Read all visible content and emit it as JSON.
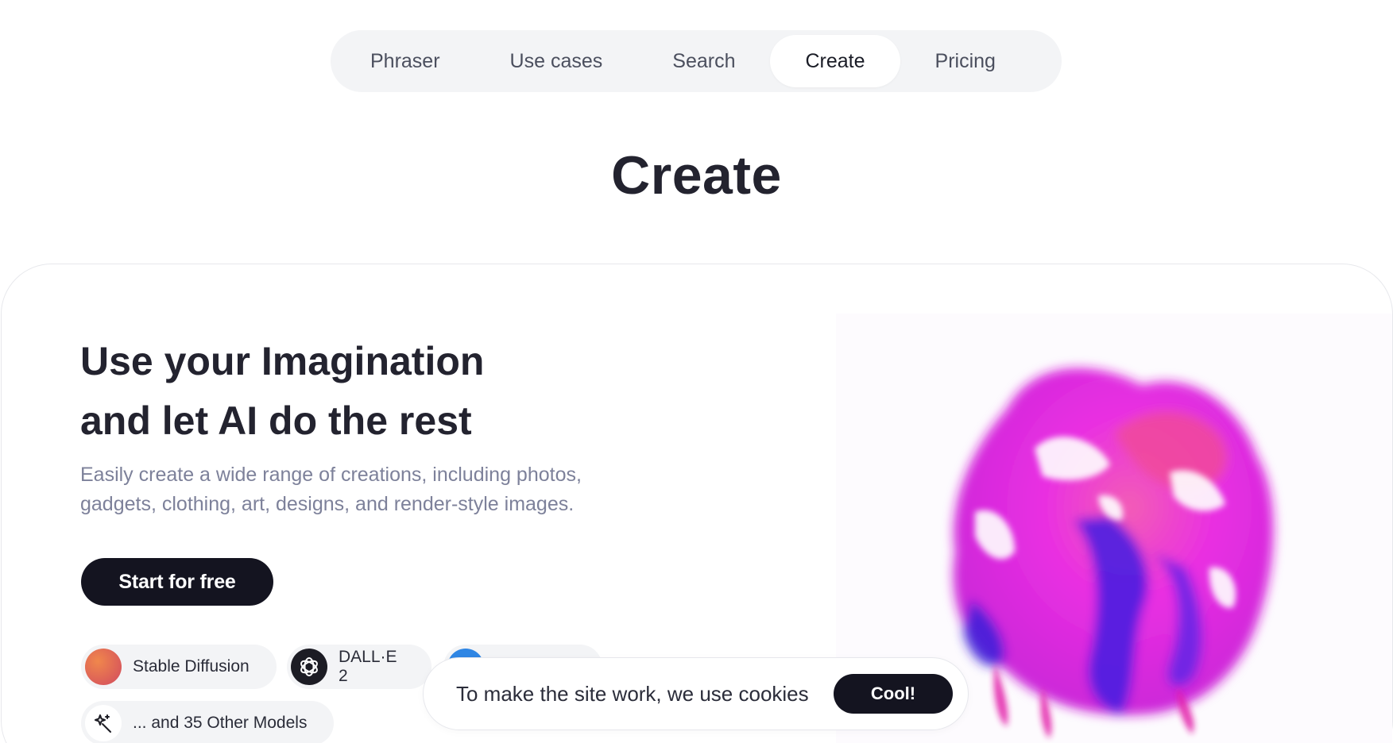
{
  "nav": {
    "items": [
      {
        "label": "Phraser",
        "active": false
      },
      {
        "label": "Use cases",
        "active": false
      },
      {
        "label": "Search",
        "active": false
      },
      {
        "label": "Create",
        "active": true
      },
      {
        "label": "Pricing",
        "active": false
      }
    ]
  },
  "page_title": "Create",
  "hero": {
    "title_line1": "Use your Imagination",
    "title_line2": "and let AI do the rest",
    "subtitle_line1": "Easily create a wide range of creations, including photos,",
    "subtitle_line2": "gadgets, clothing, art, designs, and render-style images.",
    "cta_label": "Start for free"
  },
  "models": {
    "chips": [
      {
        "label": "Stable Diffusion",
        "icon": "stable-diffusion-logo"
      },
      {
        "label": "DALL·E 2",
        "icon": "openai-logo"
      },
      {
        "label": "",
        "icon": "model-logo"
      },
      {
        "label": "... and 35 Other Models",
        "icon": "magic-wand-icon"
      }
    ]
  },
  "cookie": {
    "text": "To make the site work, we use cookies",
    "button_label": "Cool!"
  },
  "colors": {
    "accent_dark": "#141420",
    "nav_bg": "#f3f4f6",
    "subtitle": "#7d819a",
    "art_magenta": "#e81ee0",
    "art_blue": "#3a1fd8"
  }
}
